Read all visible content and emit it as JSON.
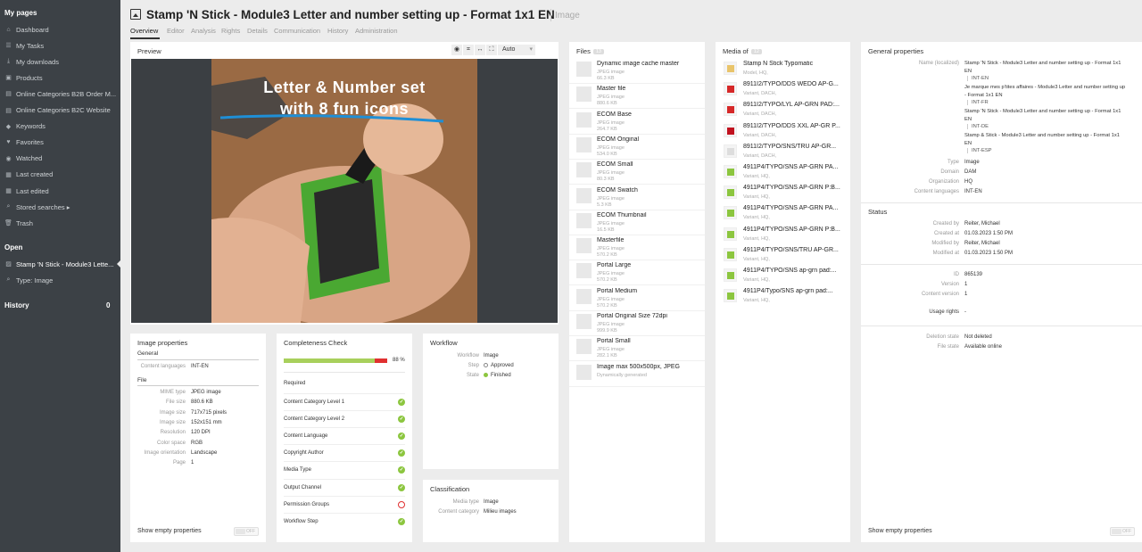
{
  "sidebar": {
    "my_pages_heading": "My pages",
    "items": [
      {
        "icon": "home-icon",
        "glyph": "⌂",
        "label": "Dashboard"
      },
      {
        "icon": "tasks-icon",
        "glyph": "☰",
        "label": "My Tasks"
      },
      {
        "icon": "download-icon",
        "glyph": "⤓",
        "label": "My downloads"
      },
      {
        "icon": "products-icon",
        "glyph": "▣",
        "label": "Products"
      },
      {
        "icon": "document-icon",
        "glyph": "▤",
        "label": "Online Categories B2B Order M..."
      },
      {
        "icon": "document-icon",
        "glyph": "▤",
        "label": "Online Categories B2C Website"
      },
      {
        "icon": "tag-icon",
        "glyph": "◆",
        "label": "Keywords"
      },
      {
        "icon": "heart-icon",
        "glyph": "♥",
        "label": "Favorites"
      },
      {
        "icon": "eye-icon",
        "glyph": "◉",
        "label": "Watched"
      },
      {
        "icon": "calendar-icon",
        "glyph": "▦",
        "label": "Last created"
      },
      {
        "icon": "calendar-edit-icon",
        "glyph": "▦",
        "label": "Last edited"
      },
      {
        "icon": "search-icon",
        "glyph": "⌕",
        "label": "Stored searches ▸"
      },
      {
        "icon": "trash-icon",
        "glyph": "🗑",
        "label": "Trash"
      }
    ],
    "open_heading": "Open",
    "open_items": [
      {
        "icon": "image-icon",
        "glyph": "▨",
        "label": "Stamp 'N Stick - Module3 Lette..."
      },
      {
        "icon": "search-icon",
        "glyph": "⌕",
        "label": "Type: Image"
      }
    ],
    "history_heading": "History",
    "history_count": "0"
  },
  "header": {
    "title": "Stamp 'N Stick - Module3 Letter and number setting up - Format 1x1 EN",
    "type_label": "Image",
    "tabs": [
      "Overview",
      "Editor",
      "Analysis",
      "Rights",
      "Details",
      "Communication",
      "History",
      "Administration"
    ]
  },
  "preview": {
    "heading": "Preview",
    "zoom_value": "Auto",
    "overlay_line1": "Letter & Number set",
    "overlay_line2": "with 8 fun icons"
  },
  "image_properties": {
    "heading": "Image properties",
    "general_heading": "General",
    "content_languages_label": "Content languages",
    "content_languages_value": "INT-EN",
    "file_heading": "File",
    "rows": [
      {
        "label": "MIME type",
        "value": "JPEG image"
      },
      {
        "label": "File size",
        "value": "880.6 KB"
      },
      {
        "label": "Image size",
        "value": "717x715 pixels"
      },
      {
        "label": "Image size",
        "value": "152x151 mm"
      },
      {
        "label": "Resolution",
        "value": "120 DPI"
      },
      {
        "label": "Color space",
        "value": "RGB"
      },
      {
        "label": "Image orientation",
        "value": "Landscape"
      },
      {
        "label": "Page",
        "value": "1"
      }
    ],
    "show_empty_label": "Show empty properties",
    "toggle_label": "OFF"
  },
  "completeness": {
    "heading": "Completeness Check",
    "percent_label": "88 %",
    "progress": 0.88,
    "required_heading": "Required",
    "items": [
      {
        "label": "Content Category Level 1",
        "status": "ok"
      },
      {
        "label": "Content Category Level 2",
        "status": "ok"
      },
      {
        "label": "Content Language",
        "status": "ok"
      },
      {
        "label": "Copyright Author",
        "status": "ok"
      },
      {
        "label": "Media Type",
        "status": "ok"
      },
      {
        "label": "Output Channel",
        "status": "ok"
      },
      {
        "label": "Permission Groups",
        "status": "missing"
      },
      {
        "label": "Workflow Step",
        "status": "ok"
      }
    ]
  },
  "workflow": {
    "heading": "Workflow",
    "workflow_label": "Workflow",
    "workflow_value": "Image",
    "step_label": "Step",
    "step_value": "Approved",
    "state_label": "State",
    "state_value": "Finished",
    "state_color": "#8cc63f"
  },
  "classification": {
    "heading": "Classification",
    "media_type_label": "Media type",
    "media_type_value": "Image",
    "content_category_label": "Content category",
    "content_category_value": "Milieu images"
  },
  "files": {
    "heading": "Files",
    "count": "13",
    "items": [
      {
        "title": "Dynamic image cache master",
        "type": "JPEG image",
        "size": "66.3 KB"
      },
      {
        "title": "Master file",
        "type": "JPEG image",
        "size": "880.6 KB"
      },
      {
        "title": "ECOM Base",
        "type": "JPEG image",
        "size": "264.7 KB"
      },
      {
        "title": "ECOM Original",
        "type": "JPEG image",
        "size": "534.0 KB"
      },
      {
        "title": "ECOM Small",
        "type": "JPEG image",
        "size": "80.3 KB"
      },
      {
        "title": "ECOM Swatch",
        "type": "JPEG image",
        "size": "5.3 KB"
      },
      {
        "title": "ECOM Thumbnail",
        "type": "JPEG image",
        "size": "16.5 KB"
      },
      {
        "title": "Masterfile",
        "type": "JPEG image",
        "size": "570.2 KB"
      },
      {
        "title": "Portal Large",
        "type": "JPEG image",
        "size": "570.2 KB"
      },
      {
        "title": "Portal Medium",
        "type": "JPEG image",
        "size": "570.2 KB"
      },
      {
        "title": "Portal Original Size 72dpi",
        "type": "JPEG image",
        "size": "999.9 KB"
      },
      {
        "title": "Portal Small",
        "type": "JPEG image",
        "size": "282.1 KB"
      },
      {
        "title": "Image max 500x500px, JPEG",
        "type": "Dynamically generated",
        "size": ""
      }
    ]
  },
  "media_of": {
    "heading": "Media of",
    "count": "12",
    "items": [
      {
        "title": "Stamp N Stick Typomatic",
        "sub": "Model, HQ,"
      },
      {
        "title": "8911I2/TYPO/DDS WEDO AP-G...",
        "sub": "Variant, DACH,"
      },
      {
        "title": "8911I2/TYPO/LYL AP-GRN PAD:...",
        "sub": "Variant, DACH,"
      },
      {
        "title": "8911I2/TYPO/DDS XXL AP-GR P...",
        "sub": "Variant, DACH,"
      },
      {
        "title": "8911I2/TYPO/SNS/TRU AP-GR...",
        "sub": "Variant, DACH,"
      },
      {
        "title": "4911P4/TYPO/SNS AP-GRN PA...",
        "sub": "Variant, HQ,"
      },
      {
        "title": "4911P4/TYPO/SNS AP-GRN P:B...",
        "sub": "Variant, HQ,"
      },
      {
        "title": "4911P4/TYPO/SNS AP-GRN PA...",
        "sub": "Variant, HQ,"
      },
      {
        "title": "4911P4/TYPO/SNS AP-GRN P:B...",
        "sub": "Variant, HQ,"
      },
      {
        "title": "4911P4/TYPO/SNS/TRU AP-GR...",
        "sub": "Variant, HQ,"
      },
      {
        "title": "4911P4/TYPO/SNS ap-grn pad:...",
        "sub": "Variant, HQ,"
      },
      {
        "title": "4911P4/Typo/SNS ap-grn pad:...",
        "sub": "Variant, HQ,"
      }
    ]
  },
  "general_properties": {
    "heading": "General properties",
    "name_label": "Name (localized)",
    "names": [
      {
        "text1": "Stamp 'N Stick - Module3 Letter and number setting up - Format 1x1",
        "text2": "EN",
        "lang": "INT-EN"
      },
      {
        "text1": "Je marque mes p'tites affaires - Module3 Letter and number setting up",
        "text2": "- Format 1x1 EN",
        "lang": "INT-FR"
      },
      {
        "text1": "Stamp 'N Stick - Module3 Letter and number setting up - Format 1x1",
        "text2": "EN",
        "lang": "INT-DE"
      },
      {
        "text1": "Stamp & Stick - Module3 Letter and number setting up - Format 1x1",
        "text2": "EN",
        "lang": "INT-ESP"
      }
    ],
    "type_label": "Type",
    "type_value": "Image",
    "domain_label": "Domain",
    "domain_value": "DAM",
    "organization_label": "Organization",
    "organization_value": "HQ",
    "content_languages_label": "Content languages",
    "content_languages_value": "INT-EN",
    "status_heading": "Status",
    "created_by_label": "Created by",
    "created_by_value": "Reiter, Michael",
    "created_at_label": "Created at",
    "created_at_value": "01.03.2023 1:50 PM",
    "modified_by_label": "Modified by",
    "modified_by_value": "Reiter, Michael",
    "modified_at_label": "Modified at",
    "modified_at_value": "01.03.2023 1:50 PM",
    "id_label": "ID",
    "id_value": "865139",
    "version_label": "Version",
    "version_value": "1",
    "content_version_label": "Content version",
    "content_version_value": "1",
    "usage_rights_label": "Usage rights",
    "usage_rights_value": "-",
    "deletion_state_label": "Deletion state",
    "deletion_state_value": "Not deleted",
    "file_state_label": "File state",
    "file_state_value": "Available online",
    "show_empty_label": "Show empty properties",
    "toggle_label": "OFF"
  }
}
